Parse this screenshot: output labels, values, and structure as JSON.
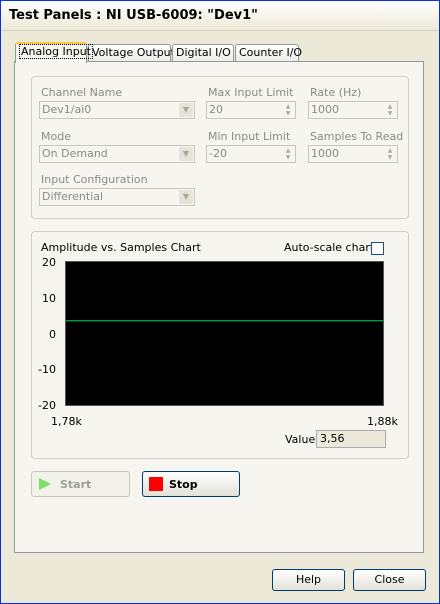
{
  "window": {
    "title": "Test Panels : NI USB-6009: \"Dev1\""
  },
  "tabs": [
    {
      "label": "Analog Input",
      "active": true
    },
    {
      "label": "Voltage Output",
      "active": false
    },
    {
      "label": "Digital I/O",
      "active": false
    },
    {
      "label": "Counter I/O",
      "active": false
    }
  ],
  "config": {
    "channel_name": {
      "label": "Channel Name",
      "value": "Dev1/ai0"
    },
    "max_input_limit": {
      "label": "Max Input Limit",
      "value": "20"
    },
    "rate": {
      "label": "Rate (Hz)",
      "value": "1000"
    },
    "mode": {
      "label": "Mode",
      "value": "On Demand"
    },
    "min_input_limit": {
      "label": "Min Input Limit",
      "value": "-20"
    },
    "samples_to_read": {
      "label": "Samples To Read",
      "value": "1000"
    },
    "input_configuration": {
      "label": "Input Configuration",
      "value": "Differential"
    }
  },
  "chart": {
    "title": "Amplitude vs. Samples Chart",
    "autoscale_label": "Auto-scale chart",
    "autoscale_checked": false,
    "value_label": "Value",
    "value": "3,56"
  },
  "chart_data": {
    "type": "line",
    "title": "Amplitude vs. Samples Chart",
    "xlabel": "",
    "ylabel": "",
    "x_tick_labels": [
      "1,78k",
      "1,88k"
    ],
    "y_tick_labels": [
      "20",
      "10",
      "0",
      "-10",
      "-20"
    ],
    "ylim": [
      -20,
      20
    ],
    "x": [
      1780,
      1880
    ],
    "values": [
      3.56,
      3.56
    ],
    "line_color": "#00b050",
    "background": "#000000",
    "grid": false
  },
  "buttons": {
    "start": "Start",
    "stop": "Stop",
    "help": "Help",
    "close": "Close"
  },
  "colors": {
    "stop_square": "#ff0000",
    "start_arrow": "#7ddf6a"
  }
}
